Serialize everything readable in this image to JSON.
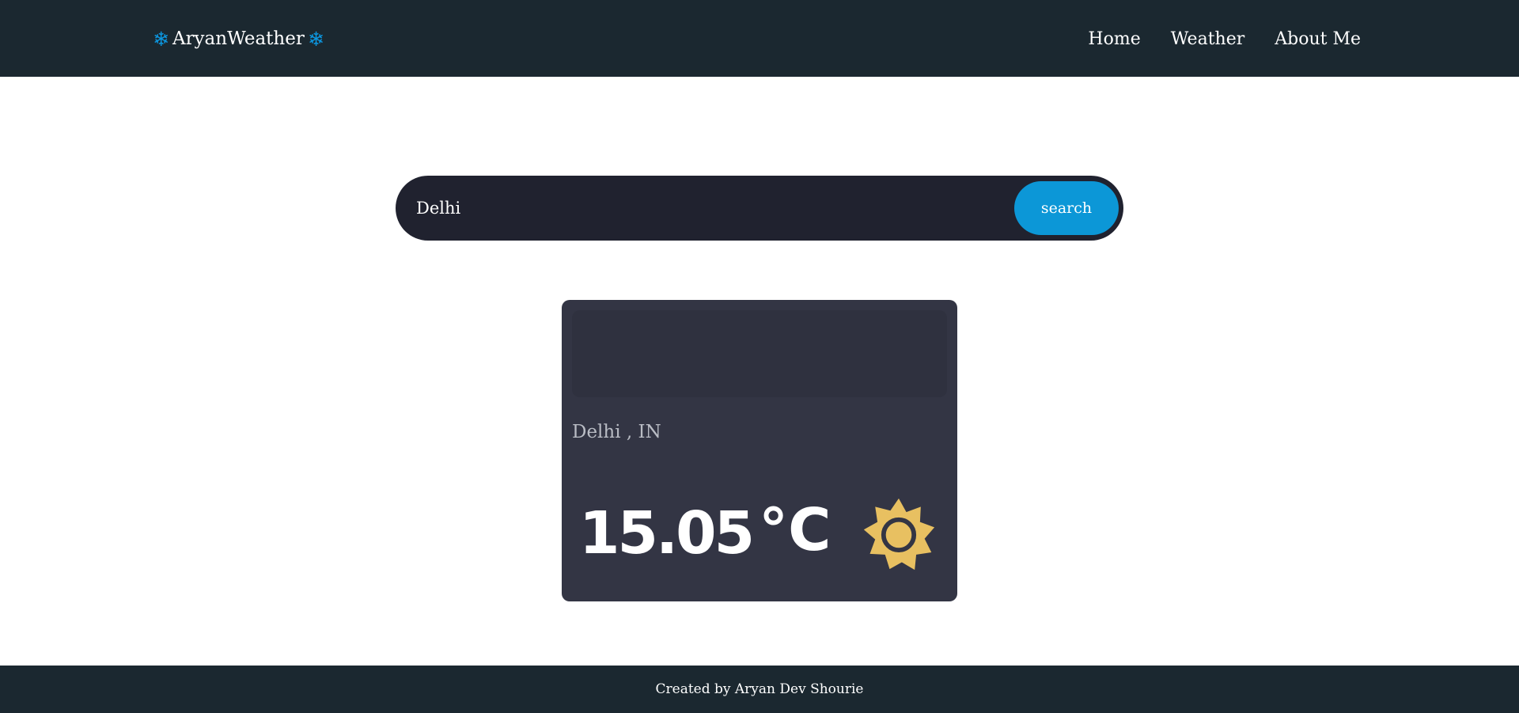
{
  "navbar": {
    "brand": "AryanWeather",
    "brand_icon": "snowflake-icon",
    "links": [
      {
        "label": "Home"
      },
      {
        "label": "Weather"
      },
      {
        "label": "About Me"
      }
    ]
  },
  "search": {
    "value": "Delhi",
    "button_label": "search"
  },
  "weather_card": {
    "location": "Delhi , IN",
    "temperature": "15.05",
    "unit": "°C",
    "condition_icon": "sun-icon"
  },
  "footer": {
    "text": "Created by Aryan Dev Shourie"
  },
  "colors": {
    "nav_bg": "#1b2830",
    "accent": "#0c97d7",
    "card_bg": "#333544",
    "search_bg": "#20222f",
    "sun": "#e8c061"
  }
}
